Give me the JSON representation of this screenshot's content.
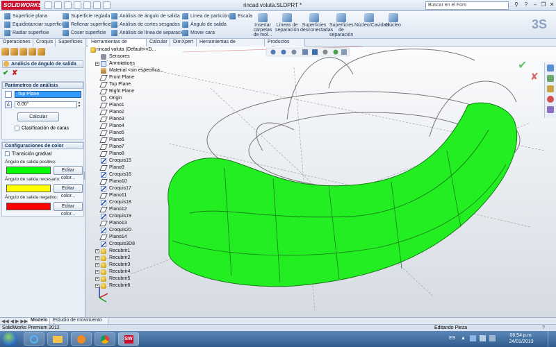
{
  "window": {
    "app_logo": "SOLIDWORKS",
    "title": "rincad voluta.SLDPRT *",
    "search_placeholder": "Buscar en el Foro",
    "help": "?"
  },
  "ribbon": {
    "col1": [
      "Superficie plana",
      "Equidistanciar superficie",
      "Radiar superficie"
    ],
    "col2": [
      "Superficie reglada",
      "Rellenar superficie",
      "Coser superficie"
    ],
    "col3": [
      "Análisis de ángulo de salida",
      "Análisis de cortes sesgados",
      "Análisis de línea de separación"
    ],
    "col4": [
      "Línea de partición",
      "Ángulo de salida",
      "Mover cara"
    ],
    "escala": "Escala",
    "big": [
      "Insertar carpetas de mol...",
      "Líneas de separación",
      "Superficies desconectadas",
      "Superficies de separación",
      "Núcleo/Cavidad",
      "Núcleo"
    ]
  },
  "tabs": [
    "Operaciones",
    "Croquis",
    "Superficies",
    "Herramientas de moldes",
    "Calcular",
    "DimXpert",
    "Herramientas de renderizado",
    "Productos Office"
  ],
  "active_tab": "Herramientas de moldes",
  "pm": {
    "title": "Análisis de ángulo de salida",
    "params_header": "Parámetros de análisis",
    "plane_value": "Top Plane",
    "angle_value": "0.00°",
    "calc_button": "Calcular",
    "face_class": "Clasificación de caras",
    "color_header": "Configuraciones de color",
    "gradual": "Transición gradual",
    "pos_label": "Ángulo de salida positivo:",
    "req_label": "Ángulo de salida necesario:",
    "neg_label": "Ángulo de salida negativo:",
    "edit_color": "Editar color...",
    "colors": {
      "positive": "#00ff00",
      "required": "#ffff00",
      "negative": "#ff0000"
    }
  },
  "tree": {
    "root": "rincad voluta  (Default<<D...",
    "items": [
      {
        "label": "Sensores",
        "icon": "sens",
        "exp": false
      },
      {
        "label": "Annotations",
        "icon": "ann",
        "exp": true
      },
      {
        "label": "Material <sin especifica...",
        "icon": "mat",
        "exp": false
      },
      {
        "label": "Front Plane",
        "icon": "plane",
        "exp": false
      },
      {
        "label": "Top Plane",
        "icon": "plane",
        "exp": false
      },
      {
        "label": "Right Plane",
        "icon": "plane",
        "exp": false
      },
      {
        "label": "Origin",
        "icon": "origin",
        "exp": false
      },
      {
        "label": "Plano1",
        "icon": "plane",
        "exp": false
      },
      {
        "label": "Plano2",
        "icon": "plane",
        "exp": false
      },
      {
        "label": "Plano3",
        "icon": "plane",
        "exp": false
      },
      {
        "label": "Plano4",
        "icon": "plane",
        "exp": false
      },
      {
        "label": "Plano5",
        "icon": "plane",
        "exp": false
      },
      {
        "label": "Plano6",
        "icon": "plane",
        "exp": false
      },
      {
        "label": "Plano7",
        "icon": "plane",
        "exp": false
      },
      {
        "label": "Plano8",
        "icon": "plane",
        "exp": false
      },
      {
        "label": "Croquis15",
        "icon": "sketch",
        "exp": false
      },
      {
        "label": "Plano9",
        "icon": "plane",
        "exp": false
      },
      {
        "label": "Croquis16",
        "icon": "sketch",
        "exp": false
      },
      {
        "label": "Plano10",
        "icon": "plane",
        "exp": false
      },
      {
        "label": "Croquis17",
        "icon": "sketch",
        "exp": false
      },
      {
        "label": "Plano11",
        "icon": "plane",
        "exp": false
      },
      {
        "label": "Croquis18",
        "icon": "sketch",
        "exp": false
      },
      {
        "label": "Plano12",
        "icon": "plane",
        "exp": false
      },
      {
        "label": "Croquis19",
        "icon": "sketch",
        "exp": false
      },
      {
        "label": "Plano13",
        "icon": "plane",
        "exp": false
      },
      {
        "label": "Croquis20",
        "icon": "sketch",
        "exp": false
      },
      {
        "label": "Plano14",
        "icon": "plane",
        "exp": false
      },
      {
        "label": "Croquis3D8",
        "icon": "sketch",
        "exp": false
      },
      {
        "label": "Recubrir1",
        "icon": "feat",
        "exp": true
      },
      {
        "label": "Recubrir2",
        "icon": "feat",
        "exp": true
      },
      {
        "label": "Recubrir3",
        "icon": "feat",
        "exp": true
      },
      {
        "label": "Recubrir4",
        "icon": "feat",
        "exp": true
      },
      {
        "label": "Recubrir5",
        "icon": "feat",
        "exp": true
      },
      {
        "label": "Recubrir6",
        "icon": "feat",
        "exp": true
      }
    ]
  },
  "bottom_tabs": [
    "Modelo",
    "Estudio de movimiento 1"
  ],
  "status": {
    "left": "SolidWorks Premium 2012",
    "right": "Editando Pieza"
  },
  "taskbar": {
    "lang": "ES",
    "time": "06:54 p.m.",
    "date": "24/01/2013"
  }
}
